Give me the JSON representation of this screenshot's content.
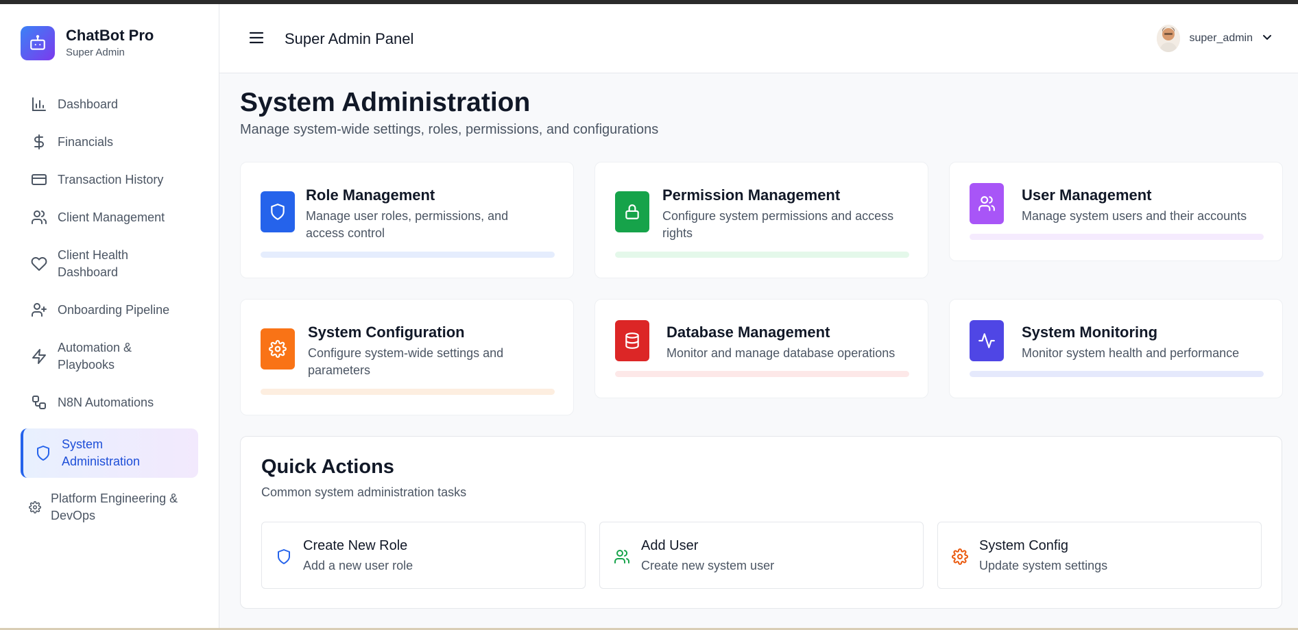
{
  "brand": {
    "name": "ChatBot Pro",
    "subtitle": "Super Admin"
  },
  "sidebar": {
    "items": [
      {
        "label": "Dashboard",
        "icon": "bar-chart-icon"
      },
      {
        "label": "Financials",
        "icon": "dollar-icon"
      },
      {
        "label": "Transaction History",
        "icon": "credit-card-icon"
      },
      {
        "label": "Client Management",
        "icon": "users-icon"
      },
      {
        "label": "Client Health Dashboard",
        "icon": "heart-icon"
      },
      {
        "label": "Onboarding Pipeline",
        "icon": "user-plus-icon"
      },
      {
        "label": "Automation & Playbooks",
        "icon": "zap-icon"
      },
      {
        "label": "N8N Automations",
        "icon": "workflow-icon"
      },
      {
        "label": "System Administration",
        "icon": "shield-icon",
        "active": true
      },
      {
        "label": "Platform Engineering & DevOps",
        "icon": "gear-icon"
      }
    ]
  },
  "header": {
    "title": "Super Admin Panel",
    "username": "super_admin"
  },
  "main": {
    "title": "System Administration",
    "subtitle": "Manage system-wide settings, roles, permissions, and configurations",
    "cards": [
      {
        "title": "Role Management",
        "description": "Manage user roles, permissions, and access control",
        "icon": "shield-icon",
        "color": "#2563eb"
      },
      {
        "title": "Permission Management",
        "description": "Configure system permissions and access rights",
        "icon": "lock-icon",
        "color": "#16a34a"
      },
      {
        "title": "User Management",
        "description": "Manage system users and their accounts",
        "icon": "users-icon",
        "color": "#9333ea"
      },
      {
        "title": "System Configuration",
        "description": "Configure system-wide settings and parameters",
        "icon": "gear-icon",
        "color": "#ea580c"
      },
      {
        "title": "Database Management",
        "description": "Monitor and manage database operations",
        "icon": "database-icon",
        "color": "#dc2626"
      },
      {
        "title": "System Monitoring",
        "description": "Monitor system health and performance",
        "icon": "activity-icon",
        "color": "#4f46e5"
      }
    ]
  },
  "quick_actions": {
    "title": "Quick Actions",
    "subtitle": "Common system administration tasks",
    "items": [
      {
        "title": "Create New Role",
        "description": "Add a new user role",
        "icon": "shield-icon",
        "color": "#2563eb"
      },
      {
        "title": "Add User",
        "description": "Create new system user",
        "icon": "users-icon",
        "color": "#16a34a"
      },
      {
        "title": "System Config",
        "description": "Update system settings",
        "icon": "gear-icon",
        "color": "#ea580c"
      }
    ]
  }
}
